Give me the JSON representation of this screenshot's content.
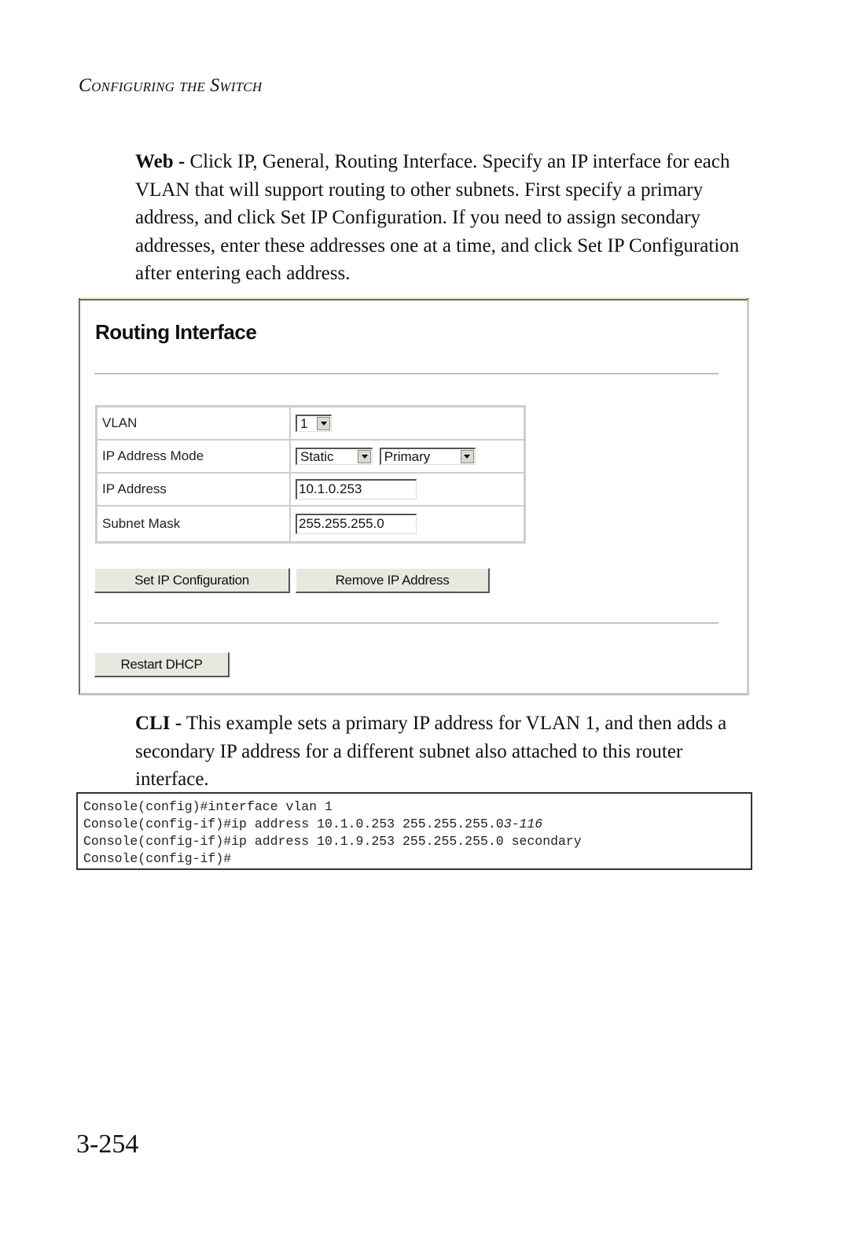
{
  "running_head": "Configuring the Switch",
  "web_paragraph": {
    "lead": "Web -",
    "text": " Click IP, General, Routing Interface. Specify an IP interface for each VLAN that will support routing to other subnets. First specify a primary address, and click Set IP Configuration. If you need to assign secondary addresses, enter these addresses one at a time, and click Set IP Configuration after entering each address."
  },
  "screenshot": {
    "title": "Routing Interface",
    "form": {
      "vlan_label": "VLAN",
      "vlan_value": "1",
      "mode_label": "IP Address Mode",
      "mode_value": "Static",
      "type_value": "Primary",
      "ip_label": "IP Address",
      "ip_value": "10.1.0.253",
      "mask_label": "Subnet Mask",
      "mask_value": "255.255.255.0"
    },
    "buttons": {
      "set": "Set IP Configuration",
      "remove": "Remove IP Address",
      "restart": "Restart DHCP"
    }
  },
  "cli_paragraph": {
    "lead": "CLI -",
    "text": " This example sets a primary IP address for VLAN 1, and then adds a secondary IP address for a different subnet also attached to this router interface."
  },
  "code": {
    "lines": [
      "Console(config)#interface vlan 1",
      "Console(config-if)#ip address 10.1.0.253 255.255.255.0",
      "Console(config-if)#ip address 10.1.9.253 255.255.255.0 secondary",
      "Console(config-if)#"
    ],
    "ref": "3-116"
  },
  "page_number": "3-254"
}
